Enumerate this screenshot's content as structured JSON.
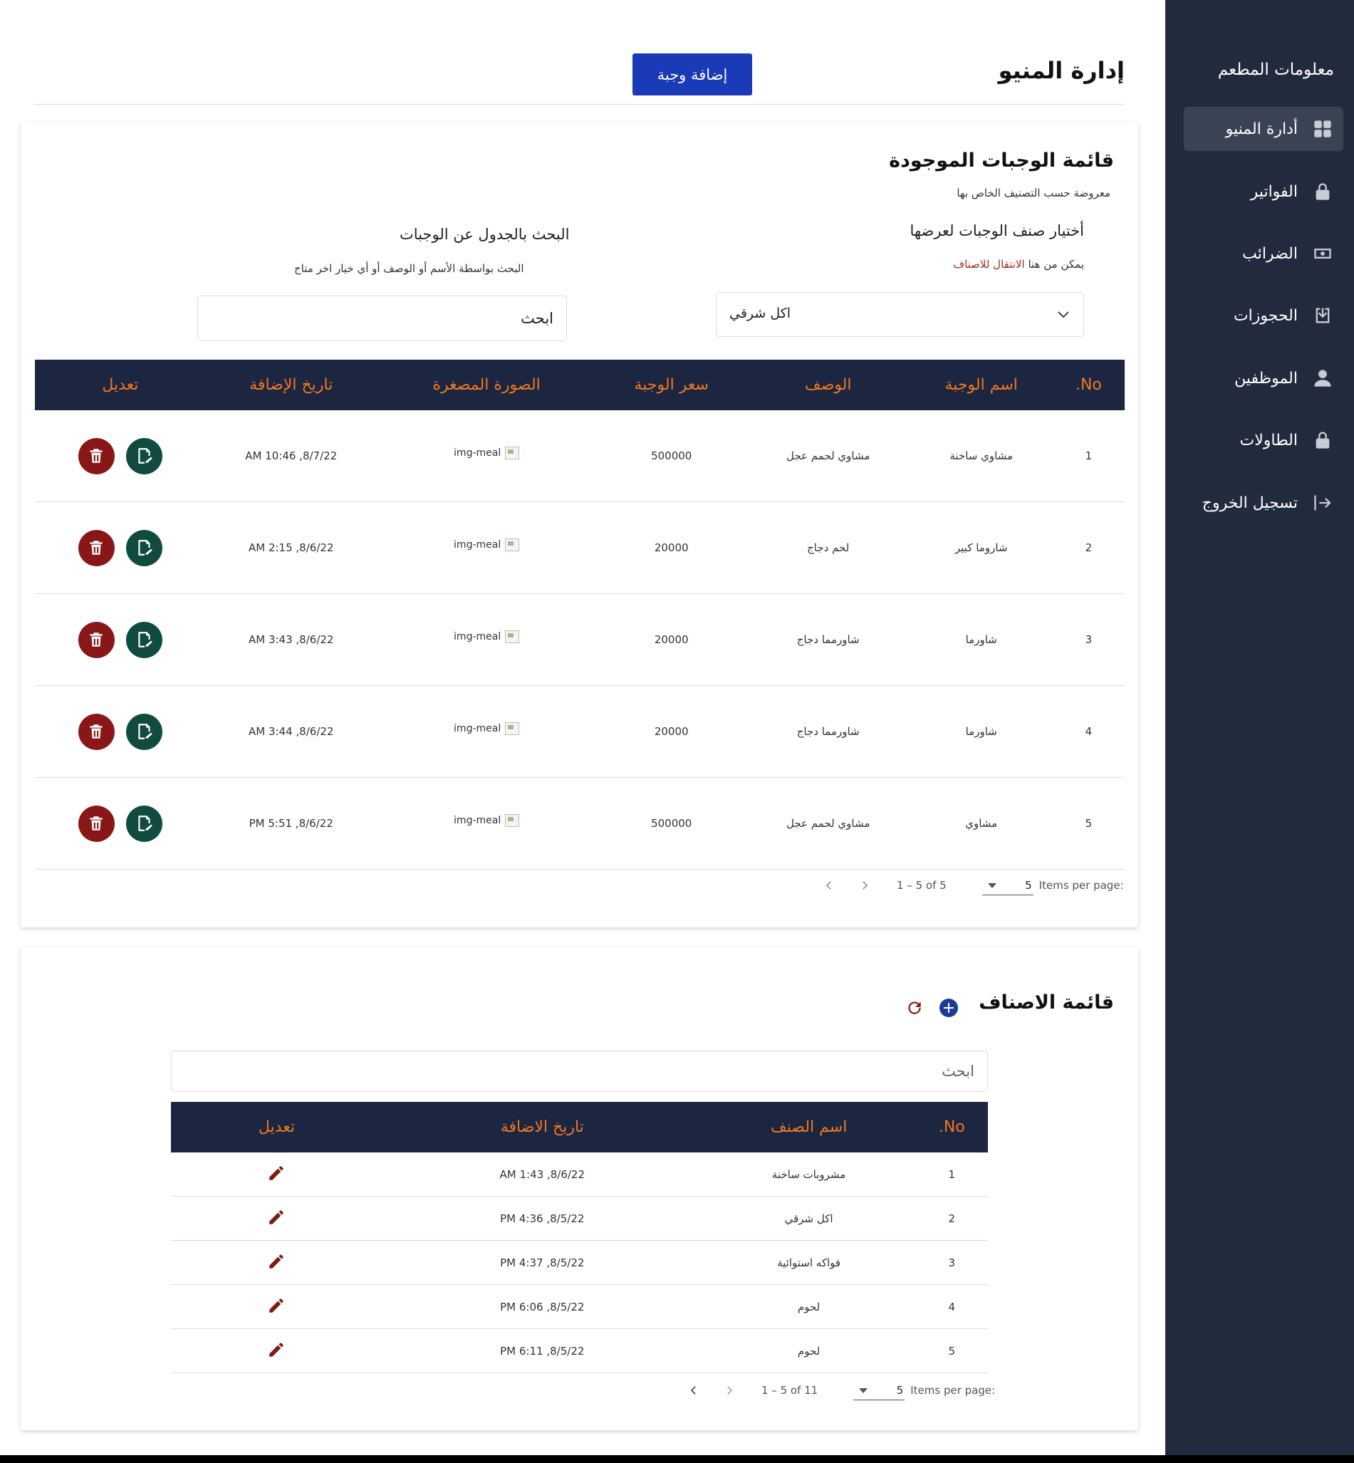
{
  "sidebar": {
    "brand": "معلومات المطعم",
    "items": [
      {
        "label": "أدارة المنيو",
        "icon": "dashboard-icon",
        "active": true
      },
      {
        "label": "الفواتير",
        "icon": "lock-icon"
      },
      {
        "label": "الضرائب",
        "icon": "money-icon"
      },
      {
        "label": "الحجوزات",
        "icon": "download-box-icon"
      },
      {
        "label": "الموظفين",
        "icon": "user-icon"
      },
      {
        "label": "الطاولات",
        "icon": "lock-icon"
      },
      {
        "label": "تسجيل الخروج",
        "icon": "logout-icon"
      }
    ]
  },
  "header": {
    "title": "إدارة المنيو",
    "add_button": "إضافة وجبة"
  },
  "meals": {
    "title": "قائمة الوجبات الموجودة",
    "subtitle": "معروضة حسب التصنيف الخاص بها",
    "category_filter": {
      "title": "أختيار صنف الوجبات لعرضها",
      "hint_prefix": "يمكن من هنا",
      "hint_link": "الانتقال للاصناف",
      "selected": "اكل شرقي"
    },
    "search": {
      "title": "البحث بالجدول عن الوجبات",
      "hint": "البحث بواسطة الأسم أو الوصف أو أي خيار اخر متاح",
      "value": "ابحث"
    },
    "columns": [
      "No.",
      "اسم الوجبة",
      "الوصف",
      "سعر الوجبة",
      "الصورة المصغرة",
      "تاريخ الإضافة",
      "تعديل"
    ],
    "rows": [
      {
        "no": "1",
        "name": "مشاوي ساخنة",
        "desc": "مشاوي لحمم عجل",
        "price": "500000",
        "img": "img-meal",
        "date": "8/7/22, 10:46 AM"
      },
      {
        "no": "2",
        "name": "شاروما كبير",
        "desc": "لحم دجاج",
        "price": "20000",
        "img": "img-meal",
        "date": "8/6/22, 2:15 AM"
      },
      {
        "no": "3",
        "name": "شاورما",
        "desc": "شاورمما دجاج",
        "price": "20000",
        "img": "img-meal",
        "date": "8/6/22, 3:43 AM"
      },
      {
        "no": "4",
        "name": "شاورما",
        "desc": "شاورمما دجاج",
        "price": "20000",
        "img": "img-meal",
        "date": "8/6/22, 3:44 AM"
      },
      {
        "no": "5",
        "name": "مشاوي",
        "desc": "مشاوي لحمم عجل",
        "price": "500000",
        "img": "img-meal",
        "date": "8/6/22, 5:51 PM"
      }
    ],
    "paginator": {
      "items_per_page_label": "Items per page:",
      "items_per_page": "5",
      "range": "1 – 5 of 5"
    }
  },
  "categories": {
    "title": "قائمة الاصناف",
    "search_placeholder": "ابحث",
    "columns": [
      "No.",
      "اسم الصنف",
      "تاريخ الاضافة",
      "تعديل"
    ],
    "rows": [
      {
        "no": "1",
        "name": "مشروبات ساخنة",
        "date": "8/6/22, 1:43 AM"
      },
      {
        "no": "2",
        "name": "اكل شرقي",
        "date": "8/5/22, 4:36 PM"
      },
      {
        "no": "3",
        "name": "فواكه استوائية",
        "date": "8/5/22, 4:37 PM"
      },
      {
        "no": "4",
        "name": "لحوم",
        "date": "8/5/22, 6:06 PM"
      },
      {
        "no": "5",
        "name": "لحوم",
        "date": "8/5/22, 6:11 PM"
      }
    ],
    "paginator": {
      "items_per_page_label": "Items per page:",
      "items_per_page": "5",
      "range": "1 – 5 of 11"
    }
  },
  "colors": {
    "sidebar_bg": "#222b3d",
    "table_header_bg": "#1c2640",
    "table_header_text": "#f07820",
    "primary": "#1a3ab8",
    "edit_btn": "#114b3f",
    "delete_btn": "#8a1717"
  }
}
